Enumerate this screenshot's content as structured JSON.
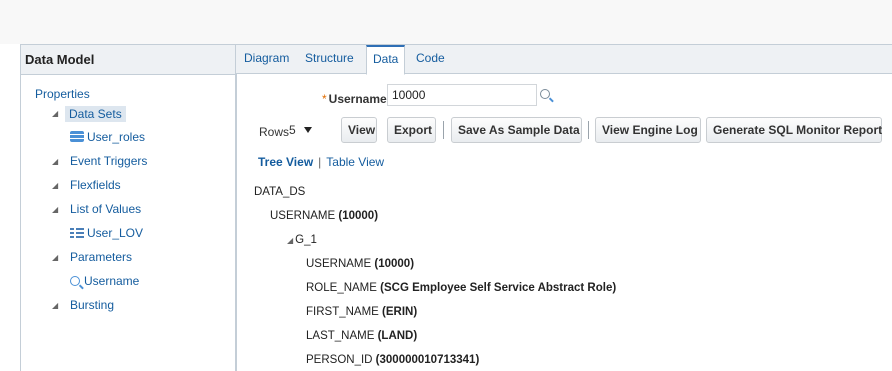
{
  "left": {
    "header": "Data Model",
    "tree": {
      "properties": "Properties",
      "data_sets": "Data Sets",
      "user_roles": "User_roles",
      "event_triggers": "Event Triggers",
      "flexfields": "Flexfields",
      "list_of_values": "List of Values",
      "user_lov": "User_LOV",
      "parameters": "Parameters",
      "username_param": "Username",
      "bursting": "Bursting"
    }
  },
  "tabs": [
    "Diagram",
    "Structure",
    "Data",
    "Code"
  ],
  "active_tab": "Data",
  "param": {
    "required_mark": "*",
    "label": "Username",
    "value": "10000"
  },
  "toolbar": {
    "rows_label": "Rows",
    "rows_value": "5",
    "view": "View",
    "export": "Export",
    "save_sample": "Save As Sample Data",
    "view_engine_log": "View Engine Log",
    "generate_sql": "Generate SQL Monitor Report"
  },
  "views": {
    "tree_view": "Tree View",
    "separator": "|",
    "table_view": "Table View"
  },
  "xml": {
    "root": "DATA_DS",
    "username_tag": "USERNAME",
    "username_val": "(10000)",
    "group": "G_1",
    "g_username_tag": "USERNAME",
    "g_username_val": "(10000)",
    "role_tag": "ROLE_NAME",
    "role_val": "(SCG Employee Self Service Abstract Role)",
    "first_tag": "FIRST_NAME",
    "first_val": "(ERIN)",
    "last_tag": "LAST_NAME",
    "last_val": "(LAND)",
    "pid_tag": "PERSON_ID",
    "pid_val": "(300000010713341)"
  },
  "icons": {
    "expanded": "triangle-down-right-icon",
    "dataset": "dataset-icon",
    "lov": "list-of-values-icon",
    "parameter": "magnifier-icon",
    "search": "search-icon",
    "dropdown": "caret-down-icon"
  },
  "colors": {
    "link": "#145c9e",
    "panel_border": "#c4ced7",
    "header_bg": "#eef1f4",
    "selected_bg": "#dde6ef",
    "required": "#e06c00"
  }
}
